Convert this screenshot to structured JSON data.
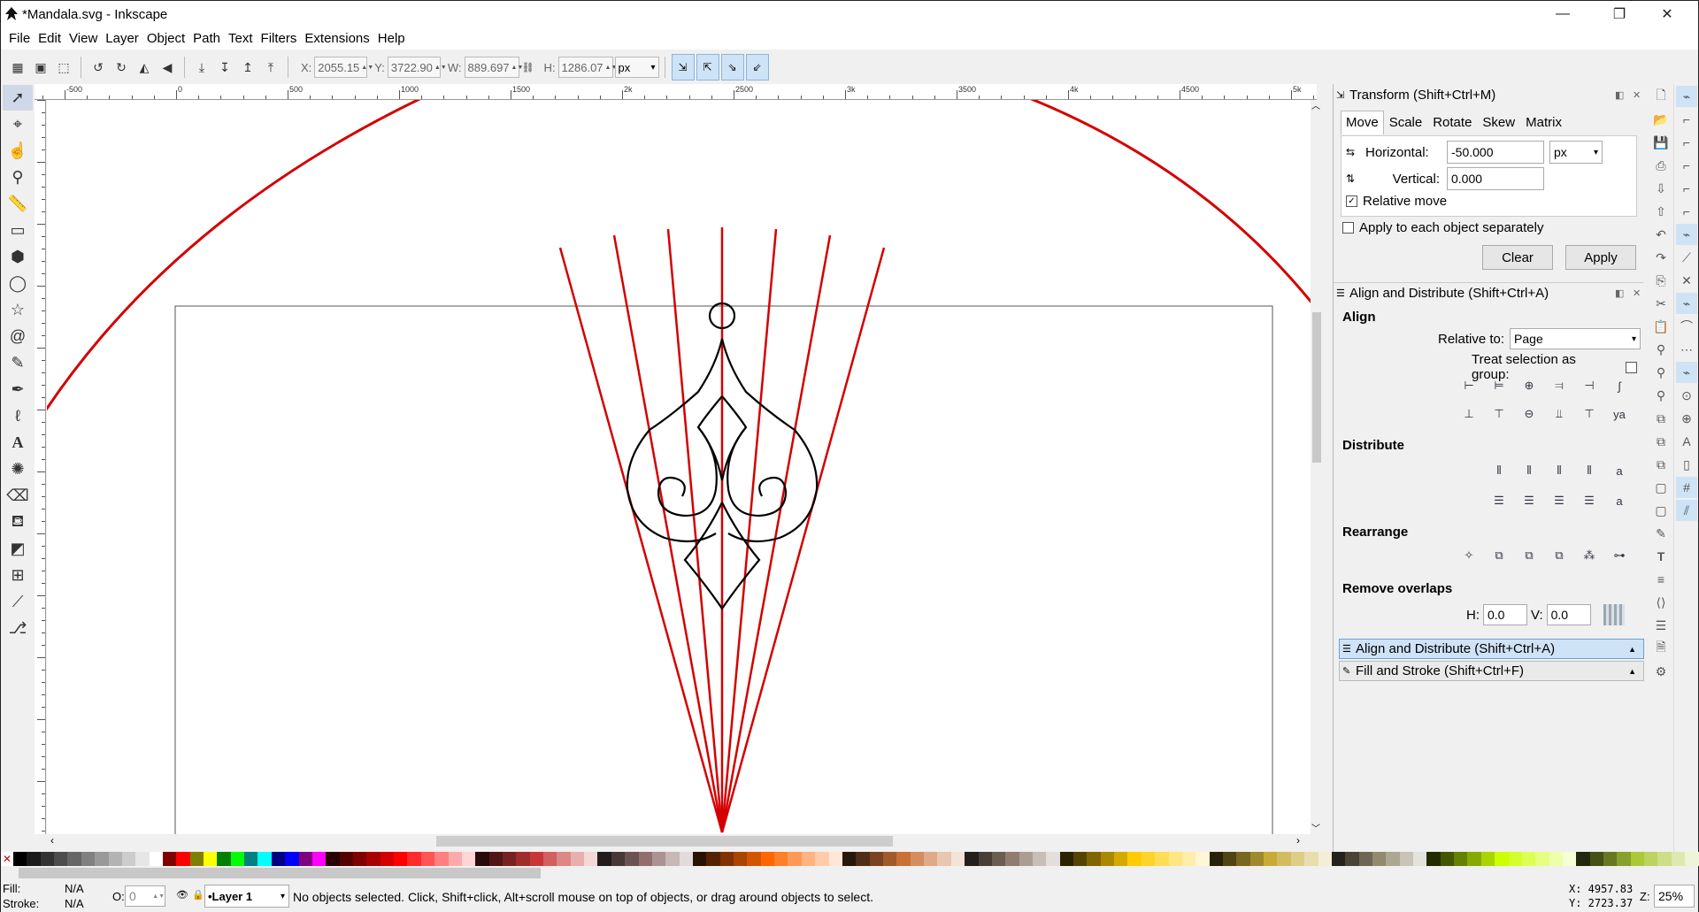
{
  "window": {
    "title": "*Mandala.svg - Inkscape",
    "minimize": "—",
    "maximize": "❐",
    "close": "✕"
  },
  "menu": [
    "File",
    "Edit",
    "View",
    "Layer",
    "Object",
    "Path",
    "Text",
    "Filters",
    "Extensions",
    "Help"
  ],
  "toolbar": {
    "x_label": "X:",
    "x_value": "2055.15",
    "y_label": "Y:",
    "y_value": "3722.90",
    "w_label": "W:",
    "w_value": "889.697",
    "h_label": "H:",
    "h_value": "1286.07",
    "unit": "px"
  },
  "ruler": {
    "h_ticks": [
      "-500",
      "0",
      "500",
      "1000",
      "1500",
      "2k",
      "2500",
      "3k",
      "3500",
      "4k",
      "4500",
      "5k"
    ]
  },
  "transform": {
    "title": "Transform (Shift+Ctrl+M)",
    "tabs": [
      "Move",
      "Scale",
      "Rotate",
      "Skew",
      "Matrix"
    ],
    "active_tab": "Move",
    "horizontal_label": "Horizontal:",
    "horizontal_value": "-50.000",
    "vertical_label": "Vertical:",
    "vertical_value": "0.000",
    "unit": "px",
    "relative_move_label": "Relative move",
    "relative_move_checked": true,
    "apply_each_label": "Apply to each object separately",
    "apply_each_checked": false,
    "clear_label": "Clear",
    "apply_label": "Apply"
  },
  "align": {
    "title": "Align and Distribute (Shift+Ctrl+A)",
    "section_align": "Align",
    "relative_to_label": "Relative to:",
    "relative_to_value": "Page",
    "treat_group_label": "Treat selection as group:",
    "section_distribute": "Distribute",
    "section_rearrange": "Rearrange",
    "section_remove_overlaps": "Remove overlaps",
    "h_label": "H:",
    "h_value": "0.0",
    "v_label": "V:",
    "v_value": "0.0"
  },
  "dock_tabs": [
    {
      "label": "Align and Distribute (Shift+Ctrl+A)",
      "active": true
    },
    {
      "label": "Fill and Stroke (Shift+Ctrl+F)",
      "active": false
    }
  ],
  "status": {
    "fill_label": "Fill:",
    "fill_value": "N/A",
    "stroke_label": "Stroke:",
    "stroke_value": "N/A",
    "opacity_label": "O:",
    "opacity_value": "0",
    "layer": "•Layer 1",
    "message": "No objects selected. Click, Shift+click, Alt+scroll mouse on top of objects, or drag around objects to select.",
    "cursor_x": "X: 4957.83",
    "cursor_y": "Y: 2723.37",
    "zoom_label": "Z:",
    "zoom_value": "25%"
  },
  "colors": {
    "accent": "#cfe3f7",
    "guide_red": "#d40000",
    "stroke_black": "#000000"
  },
  "palette": [
    "#000000",
    "#1a1a1a",
    "#333333",
    "#4d4d4d",
    "#666666",
    "#808080",
    "#999999",
    "#b3b3b3",
    "#cccccc",
    "#e6e6e6",
    "#ffffff",
    "#800000",
    "#ff0000",
    "#808000",
    "#ffff00",
    "#008000",
    "#00ff00",
    "#008080",
    "#00ffff",
    "#000080",
    "#0000ff",
    "#800080",
    "#ff00ff",
    "#2b0000",
    "#550000",
    "#800000",
    "#aa0000",
    "#d40000",
    "#ff0000",
    "#ff2a2a",
    "#ff5555",
    "#ff8080",
    "#ffaaaa",
    "#ffd5d5",
    "#280b0b",
    "#501616",
    "#782121",
    "#a02c2c",
    "#c83737",
    "#d35f5f",
    "#de8787",
    "#e9afaf",
    "#f4d7d7",
    "#241c1c",
    "#483737",
    "#6c5353",
    "#916f6f",
    "#ac9393",
    "#c8b7b7",
    "#e3dbdb",
    "#2b1100",
    "#552200",
    "#803300",
    "#aa4400",
    "#d45500",
    "#ff6600",
    "#ff7f2a",
    "#ff9955",
    "#ffb380",
    "#ffccaa",
    "#ffe6d5",
    "#28170b",
    "#502d16",
    "#784421",
    "#a05a2c",
    "#c87137",
    "#d38d5f",
    "#deaa87",
    "#e9c6af",
    "#f4e3d7",
    "#241f1c",
    "#483e37",
    "#6c5d53",
    "#917c6f",
    "#ac9d93",
    "#c8beb7",
    "#e3dedb",
    "#2b2200",
    "#554400",
    "#806600",
    "#aa8800",
    "#d4aa00",
    "#ffcc00",
    "#ffd42a",
    "#ffdd55",
    "#ffe680",
    "#ffeeaa",
    "#fff6d5",
    "#28220b",
    "#504416",
    "#786721",
    "#a0892c",
    "#c8ab37",
    "#d3bc5f",
    "#decd87",
    "#e9ddaf",
    "#f4eed7",
    "#24221c",
    "#484537",
    "#6c6753",
    "#918a6f",
    "#aca793",
    "#c8c4b7",
    "#e3e2db",
    "#222b00",
    "#445500",
    "#668000",
    "#88aa00",
    "#aad400",
    "#ccff00",
    "#d4ff2a",
    "#ddff55",
    "#e5ff80",
    "#eeffaa",
    "#f6ffd5",
    "#22280b",
    "#445016",
    "#677821",
    "#89a02c",
    "#abc837",
    "#bcd35f",
    "#cdde87",
    "#dde9af",
    "#eef4d7"
  ]
}
